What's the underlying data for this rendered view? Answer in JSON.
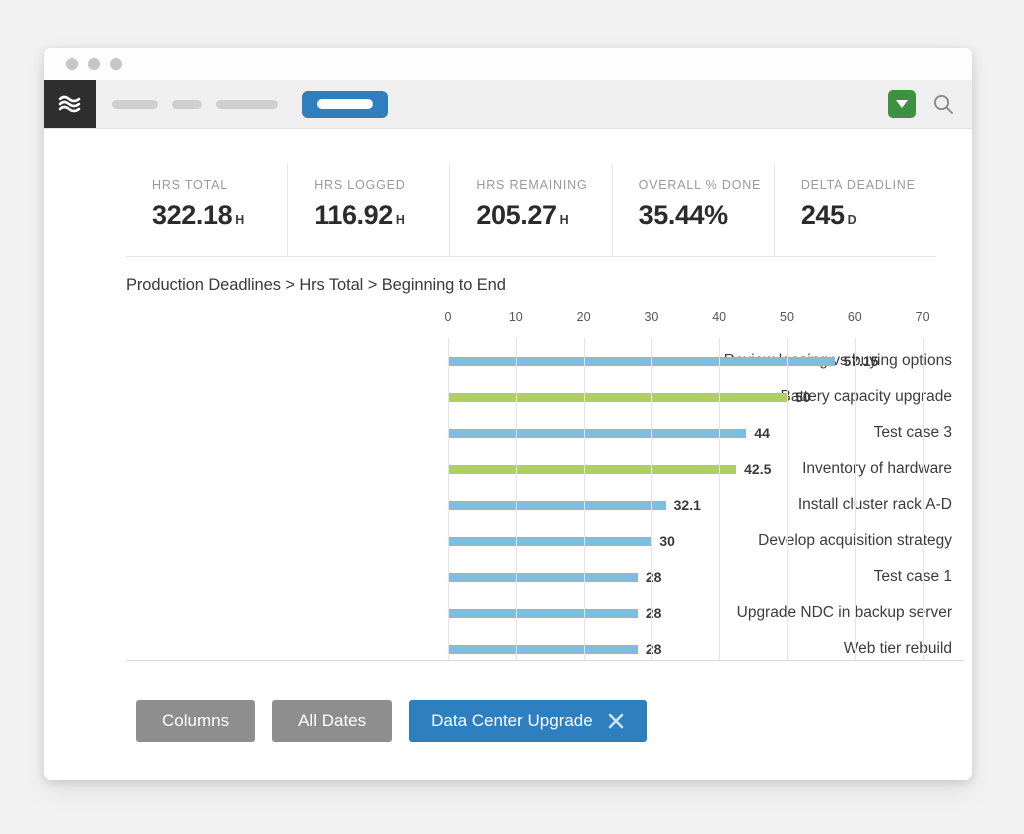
{
  "window": {
    "traffic_lights": [
      "close",
      "minimize",
      "zoom"
    ]
  },
  "appbar": {
    "logo_icon": "waves-logo-icon",
    "nav_items": [
      {
        "name": "nav-pill-1"
      },
      {
        "name": "nav-pill-2"
      },
      {
        "name": "nav-pill-3"
      }
    ],
    "active_nav_item": "nav-pill-active",
    "filter_button_icon": "caret-down-icon",
    "search_icon": "search-icon",
    "accent_green": "#3f9142",
    "accent_blue": "#2e7fbf"
  },
  "kpis": [
    {
      "label": "HRS TOTAL",
      "value": "322.18",
      "unit": "H"
    },
    {
      "label": "HRS LOGGED",
      "value": "116.92",
      "unit": "H"
    },
    {
      "label": "HRS REMAINING",
      "value": "205.27",
      "unit": "H"
    },
    {
      "label": "OVERALL % DONE",
      "value": "35.44%",
      "unit": ""
    },
    {
      "label": "DELTA DEADLINE",
      "value": "245",
      "unit": "D"
    }
  ],
  "breadcrumb": "Production Deadlines > Hrs Total > Beginning to End",
  "chart_data": {
    "type": "bar",
    "orientation": "horizontal",
    "title": "Production Deadlines > Hrs Total > Beginning to End",
    "xlabel": "",
    "ylabel": "",
    "xlim": [
      0,
      70
    ],
    "xticks": [
      0,
      10,
      20,
      30,
      40,
      50,
      60,
      70
    ],
    "grid": true,
    "legend": false,
    "colors": {
      "blue": "#7ebedd",
      "green": "#aed15c"
    },
    "categories": [
      "Review leasing vs buying options",
      "Battery capacity upgrade",
      "Test case 3",
      "Inventory of hardware",
      "Install cluster rack A-D",
      "Develop acquisition strategy",
      "Test case 1",
      "Upgrade NDC in backup server",
      "Web tier rebuild"
    ],
    "values": [
      57.15,
      50,
      44,
      42.5,
      32.1,
      30,
      28,
      28,
      28
    ],
    "value_labels": [
      "57.15",
      "50",
      "44",
      "42.5",
      "32.1",
      "30",
      "28",
      "28",
      "28"
    ],
    "bar_colors": [
      "blue",
      "green",
      "blue",
      "green",
      "blue",
      "blue",
      "blue",
      "blue",
      "blue"
    ]
  },
  "footer": {
    "columns_label": "Columns",
    "all_dates_label": "All Dates",
    "filter_chip_label": "Data Center Upgrade",
    "filter_chip_close_icon": "close-icon"
  }
}
